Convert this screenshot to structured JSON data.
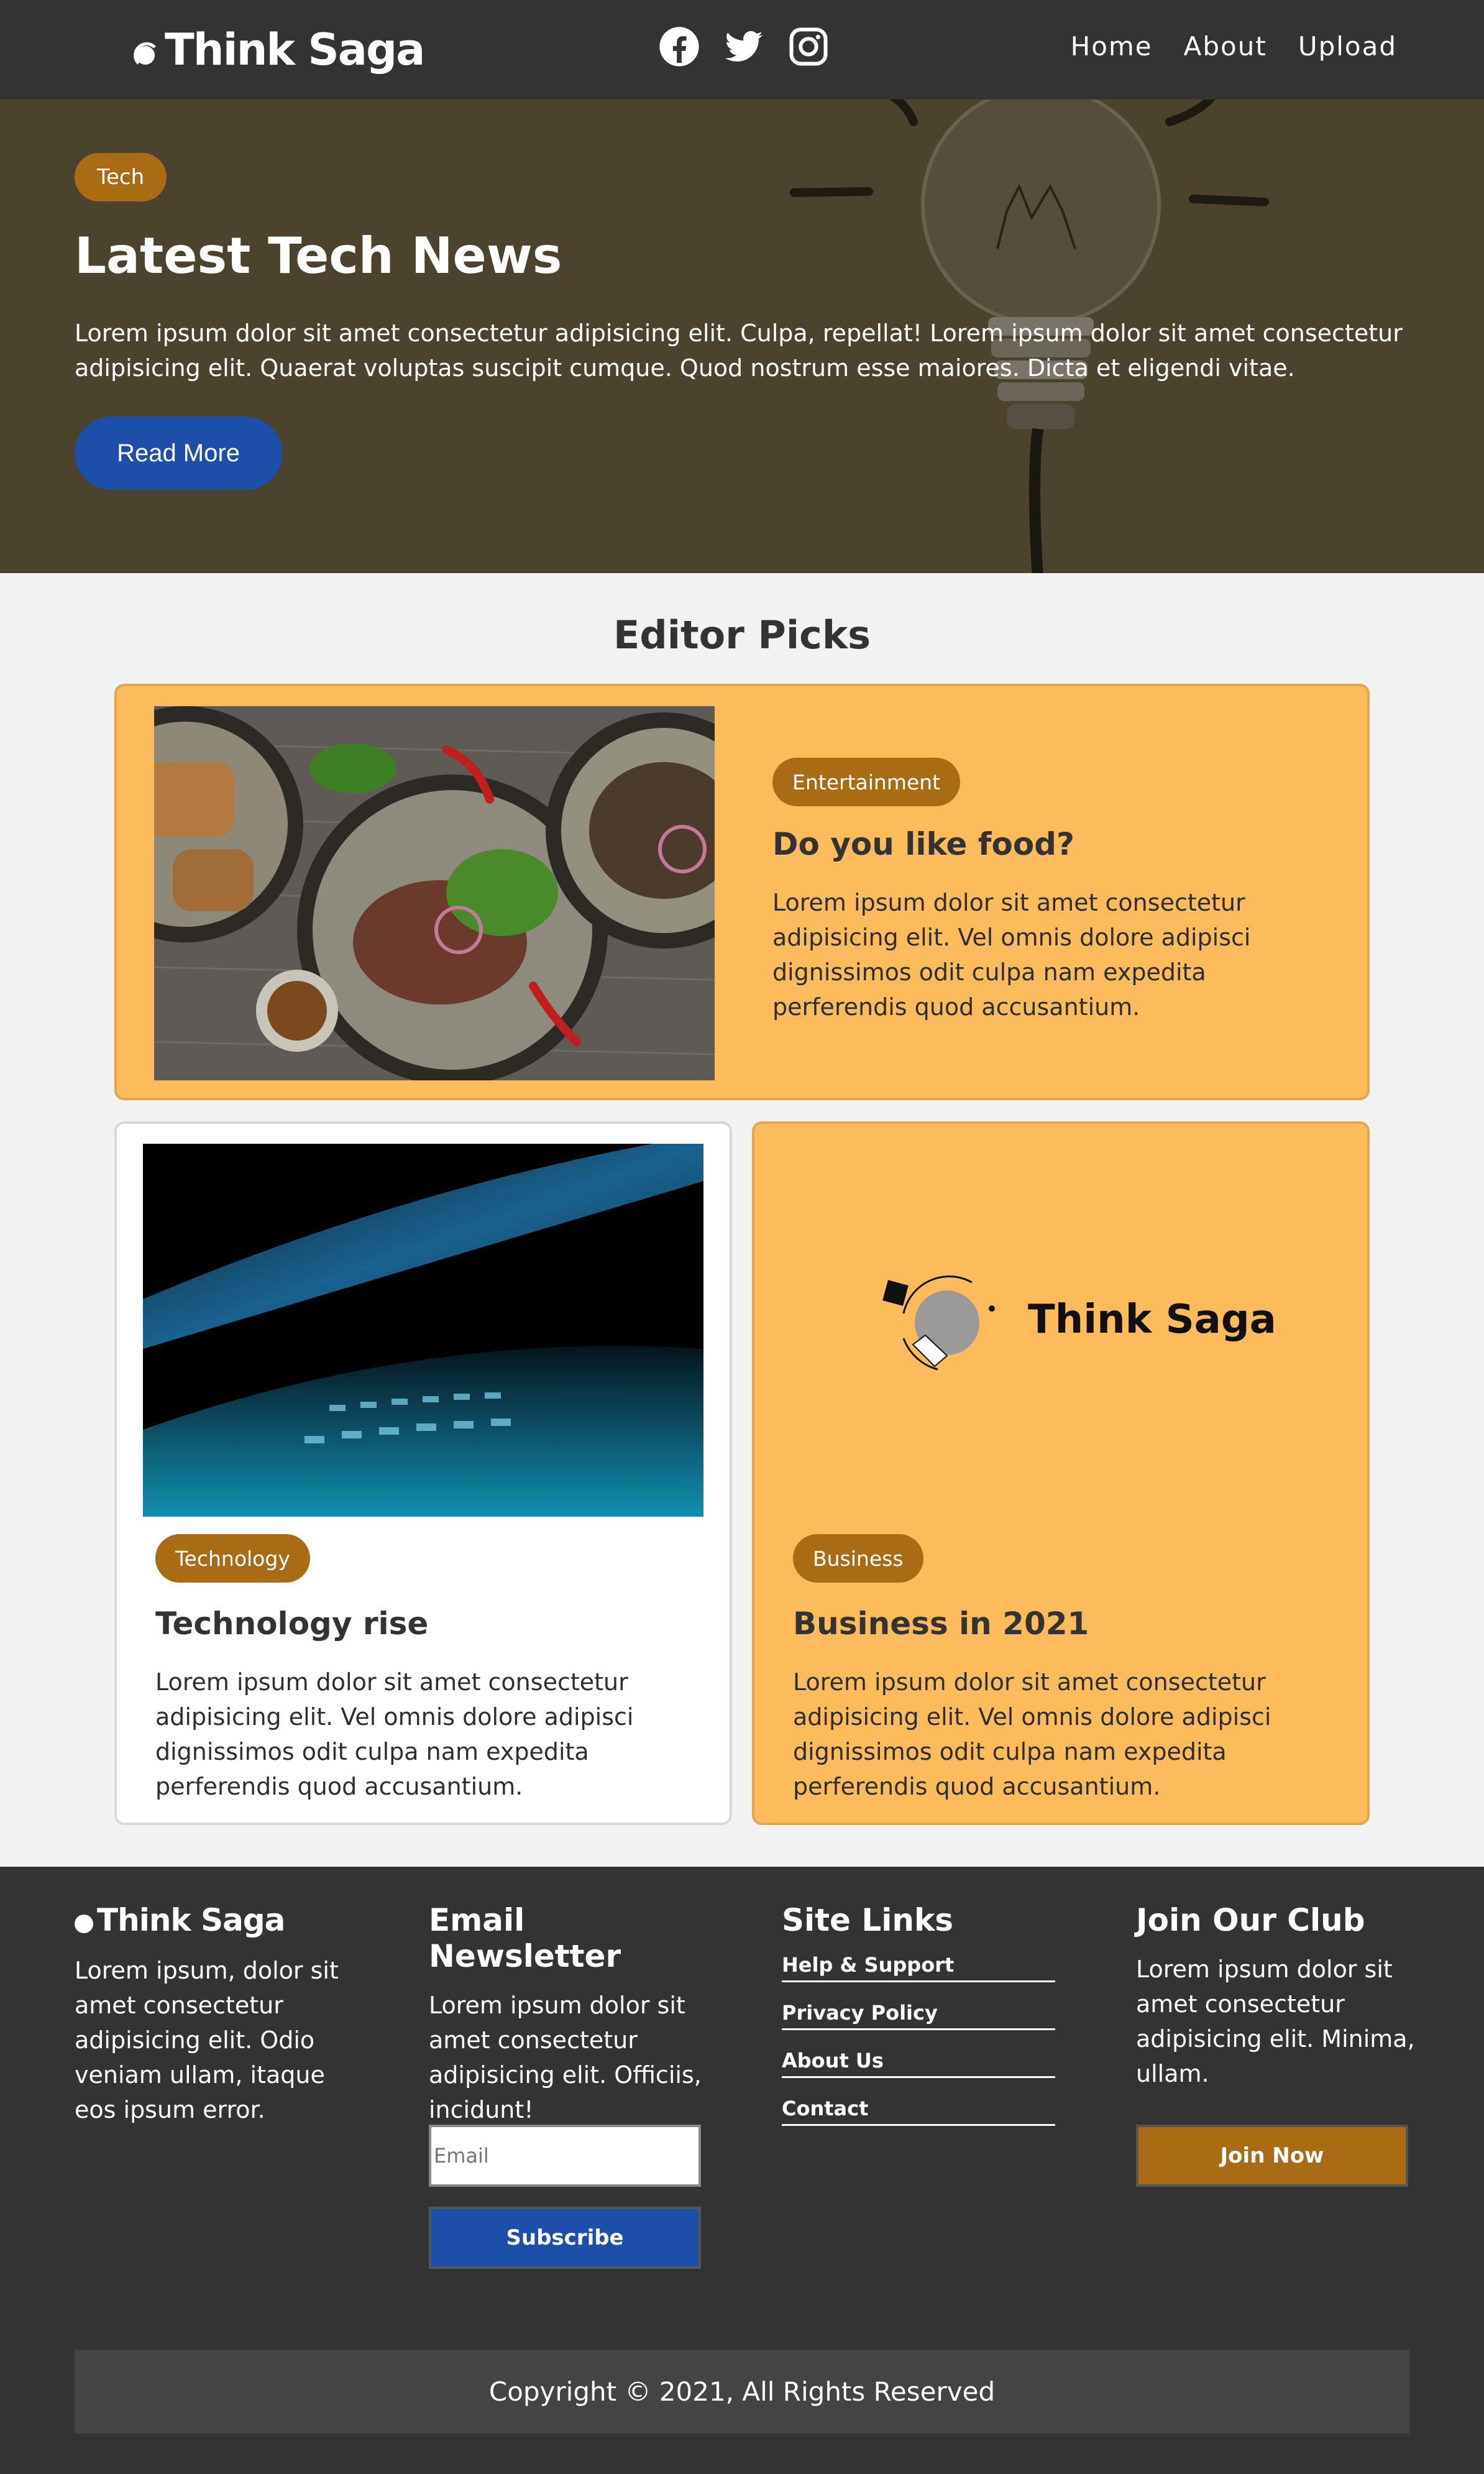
{
  "header": {
    "logo_text": "Think Saga",
    "social": [
      "facebook-icon",
      "twitter-icon",
      "instagram-icon"
    ],
    "nav": [
      {
        "label": "Home"
      },
      {
        "label": "About"
      },
      {
        "label": "Upload"
      }
    ]
  },
  "hero": {
    "tag": "Tech",
    "title": "Latest Tech News",
    "text": "Lorem ipsum dolor sit amet consectetur adipisicing elit. Culpa, repellat! Lorem ipsum dolor sit amet consectetur adipisicing elit. Quaerat voluptas suscipit cumque. Quod nostrum esse maiores. Dicta et eligendi vitae.",
    "button": "Read More"
  },
  "editor_picks": {
    "title": "Editor Picks",
    "cards": [
      {
        "tag": "Entertainment",
        "title": "Do you like food?",
        "text": "Lorem ipsum dolor sit amet consectetur adipisicing elit. Vel omnis dolore adipisci dignissimos odit culpa nam expedita perferendis quod accusantium."
      },
      {
        "tag": "Technology",
        "title": "Technology rise",
        "text": "Lorem ipsum dolor sit amet consectetur adipisicing elit. Vel omnis dolore adipisci dignissimos odit culpa nam expedita perferendis quod accusantium."
      },
      {
        "logo_text": "Think Saga",
        "tag": "Business",
        "title": "Business in 2021",
        "text": "Lorem ipsum dolor sit amet consectetur adipisicing elit. Vel omnis dolore adipisci dignissimos odit culpa nam expedita perferendis quod accusantium."
      }
    ]
  },
  "footer": {
    "logo_text": "Think Saga",
    "about_text": "Lorem ipsum, dolor sit amet consectetur adipisicing elit. Odio veniam ullam, itaque eos ipsum error.",
    "newsletter": {
      "heading": "Email Newsletter",
      "text": "Lorem ipsum dolor sit amet consectetur adipisicing elit. Officiis, incidunt!",
      "placeholder": "Email",
      "button": "Subscribe"
    },
    "links": {
      "heading": "Site Links",
      "items": [
        "Help & Support",
        "Privacy Policy",
        "About Us",
        "Contact"
      ]
    },
    "club": {
      "heading": "Join Our Club",
      "text": "Lorem ipsum dolor sit amet consectetur adipisicing elit. Minima, ullam.",
      "button": "Join Now"
    },
    "copyright": "Copyright © 2021, All Rights Reserved"
  },
  "colors": {
    "header_bg": "#333333",
    "hero_bg": "#4c432e",
    "tag_bg": "#a96b14",
    "primary_button": "#1b4fa9",
    "card_orange": "#fdbb5c"
  }
}
